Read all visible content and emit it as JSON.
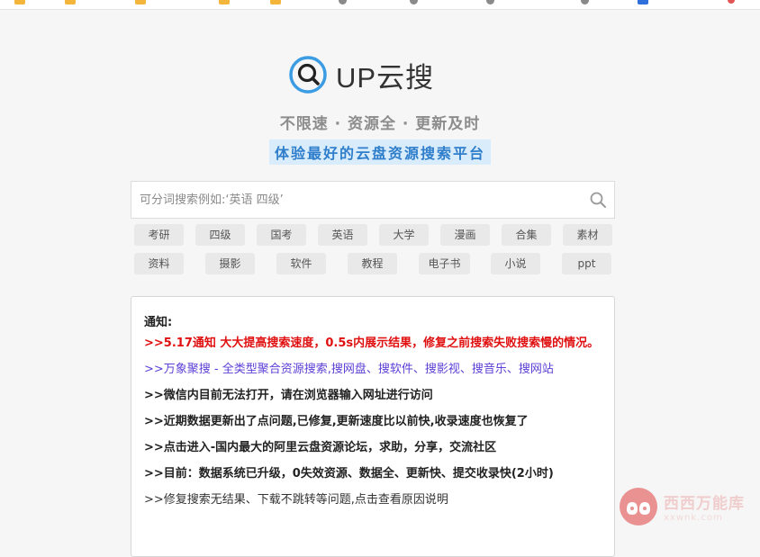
{
  "brand": {
    "name": "UP云搜",
    "slogan": "不限速 · 资源全 · 更新及时",
    "subtitle": "体验最好的云盘资源搜索平台"
  },
  "search": {
    "placeholder": "可分词搜索例如:‘英语 四级’"
  },
  "tags_row1": [
    "考研",
    "四级",
    "国考",
    "英语",
    "大学",
    "漫画",
    "合集",
    "素材"
  ],
  "tags_row2": [
    "资料",
    "摄影",
    "软件",
    "教程",
    "电子书",
    "小说",
    "ppt"
  ],
  "notice": {
    "title": "通知:",
    "lines": [
      ">>5.17通知 大大提高搜索速度，0.5s内展示结果，修复之前搜索失败搜索慢的情况。",
      ">>万象聚搜 - 全类型聚合资源搜索,搜网盘、搜软件、搜影视、搜音乐、搜网站",
      ">>微信内目前无法打开，请在浏览器输入网址进行访问",
      ">>近期数据更新出了点问题,已修复,更新速度比以前快,收录速度也恢复了",
      ">>点击进入-国内最大的阿里云盘资源论坛，求助，分享，交流社区",
      ">>目前：数据系统已升级，0失效资源、数据全、更新快、提交收录快(2小时)",
      ">>修复搜索无结果、下载不跳转等问题,点击查看原因说明"
    ]
  },
  "watermark": {
    "main": "西西万能库",
    "sub": "xxwnk.com"
  },
  "colors": {
    "accent_blue": "#2f7ecb",
    "logo_blue": "#3b9be3",
    "notice_red": "#e01010",
    "notice_purple": "#5c3fd6"
  }
}
